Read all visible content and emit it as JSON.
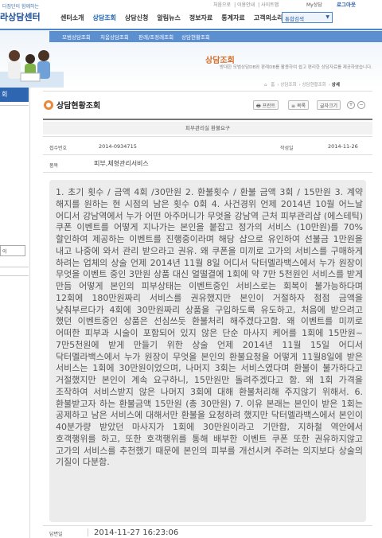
{
  "header": {
    "logo_tagline": "다짐단이 함께하는",
    "logo_name": "라상담센터",
    "util_links": [
      "처음으로",
      "이용안내",
      "사이트맵"
    ],
    "login": "My상담",
    "logout": "로그아웃",
    "gnb": [
      "센터소개",
      "상담조회",
      "상담신청",
      "알림뉴스",
      "정보자료",
      "통계자료",
      "고객의소리"
    ],
    "gnb_active_index": 1,
    "search_label": "통합검색"
  },
  "subnav": [
    "모범상담조회",
    "처움상담조회",
    "판례/조정례조회",
    "상담현황조회"
  ],
  "banner": {
    "title": "상담조회",
    "desc": "방대한 모범상담DB와 판례DB를 활용하여 쉽고 편리한 상담자료를 제공하였습니다."
  },
  "leftrail": {
    "label": "회",
    "search_value": "이"
  },
  "breadcrumb": [
    "홈",
    "상담조회",
    "상담현황조회",
    "상세"
  ],
  "page": {
    "title": "상담현황조회",
    "buttons": [
      "프린트",
      "목록",
      "글자크기"
    ]
  },
  "record": {
    "category": "피부관리실 환불요구",
    "id_label": "접수번호",
    "id_value": "2014-0934715",
    "date_label": "작성일",
    "date_value": "2014-11-26",
    "subject_label": "품목",
    "subject_value": "피부,체형관리서비스",
    "content": "1. 초기 횟수 / 금액 4회 /30만원 2. 환불횟수 / 환불 금액 3회 / 15만원 3. 계약 해지를 원하는 현 시점의 남은 횟수 0회 4. 사건경위 언제 2014년 10월 어느날 어디서 강남역에서 누가 어떤 아주머니가 무엇을 강남역 근처 피부관리샵 (에스테틱) 쿠폰 이벤트를 어떻게 지나가는 본인을 붙잡고 정가의 서비스 (10만원)를 70% 할인하여 제공하는 이벤트를 진행중이라며 해당 샵으로 유인하여 선불금 1만원을 내고 나중에 와서 관리 받으라고 권유. 왜 쿠폰을 미끼로 고가의 서비스를 구매하게 하려는 업체의 상술 언제 2014년 11월 8일 어디서 닥터멜라백스에서 누가 원장이 무엇을 이벤트 중인 3만원 상품 대신 얼떨결에 1회에 약 7만 5천원인 서비스를 받게 만듬 어떻게 본인의 피부상태는 이벤트중인 서비스로는 회복이 불가능하다며 12회에 180만원짜리 서비스를 권유했지만 본인이 거절하자 점점 금액을 낮춰부르다가 4회에 30만원짜리 상품을 구입하도록 유도하고, 처음에 받으려고 했던 이벤트중인 상품은 선심쓰듯 환불처리 해주겠다고함. 왜 이벤트를 미끼로 어떠한 피부과 시술이 포함되어 있지 않은 단순 마사지 케어를 1회에 15만원~ 7만5천원에 받게 만들기 위한 상술 언제 2014년 11월 15일 어디서 닥터멜라백스에서 누가 원장이 무엇을 본인의 환불요청을 어떻게 11월8일에 받은 서비스는 1회에 30만원이었으며, 나머지 3회는 서비스였다며 환불이 불가하다고 거절했지만 본인이 계속 요구하니, 15만원만 돌려주겠다고 함. 왜 1회 가격을 조작하여 서비스받지 않은 나머지 3회에 대해 환불처리해 주지않기 위해서. 6. 환불받고자 하는 환불금액 15만원 (총 30만원) 7. 이유 본래는 본인이 받은 1회는 공제하고 남은 서비스에 대해서만 환불을 요청하려 했지만 닥터멜라백스에서 본인이 40분가량 받았던 마사지가 1회에 30만원이라고 기만함, 지하철 역안에서 호객행위를 하고, 또한 호객행위를 통해 배부한 이벤트 쿠폰 또한 권유하지않고 고가의 서비스를 추천했기 때문에 본인의 피부를 개선시켜 주려는 의지보다 상술의 기질이 다분함."
  },
  "answer": {
    "label": "답변일",
    "date": "2014-11-27 16:23:06"
  },
  "colors": {
    "accent": "#1d63b6",
    "subnav": "#5b8fd0",
    "title_icon": "#e98a3b"
  }
}
